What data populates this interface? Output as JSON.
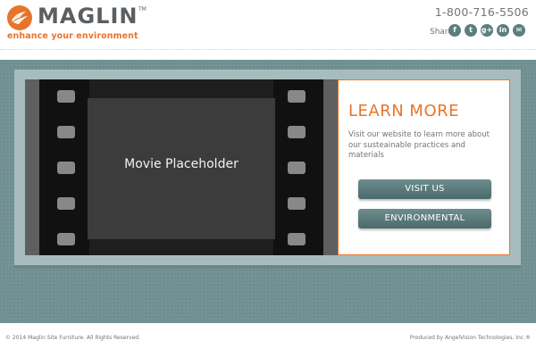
{
  "header": {
    "brand": "MAGLIN",
    "trademark": "TM",
    "tagline": "enhance your environment",
    "phone": "1-800-716-5506",
    "share_label": "Share:",
    "social": [
      {
        "name": "facebook-icon",
        "glyph": "f"
      },
      {
        "name": "twitter-icon",
        "glyph": "t"
      },
      {
        "name": "google-plus-icon",
        "glyph": "g+"
      },
      {
        "name": "linkedin-icon",
        "glyph": "in"
      },
      {
        "name": "email-icon",
        "glyph": "✉"
      }
    ]
  },
  "video": {
    "placeholder_label": "Movie Placeholder"
  },
  "panel": {
    "title": "LEARN MORE",
    "text": "Visit our website to learn more about our susteainable practices and materials",
    "buttons": [
      "VISIT US",
      "ENVIRONMENTAL"
    ]
  },
  "footer": {
    "copyright": "© 2014 Maglin Site Furniture. All Rights Reserved.",
    "credit": "Produced by AngelVision Technologies, Inc.®"
  },
  "colors": {
    "accent": "#e8742a",
    "teal": "#6f8f91",
    "button": "#5b7a7b",
    "text": "#6f7478"
  }
}
